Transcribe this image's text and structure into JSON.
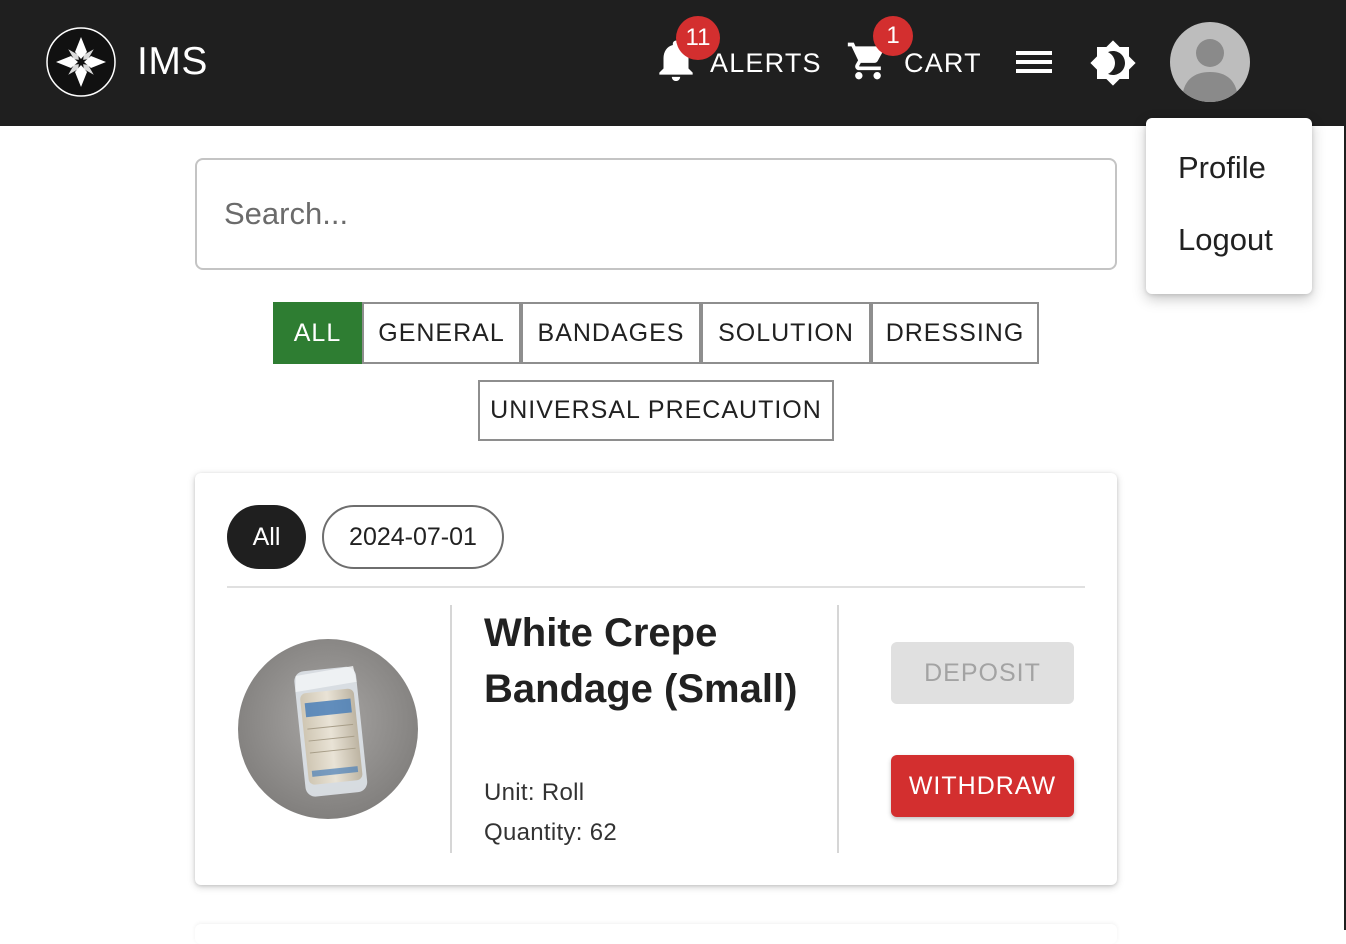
{
  "app": {
    "title": "IMS",
    "logo_icon": "maltese-cross-icon"
  },
  "nav": {
    "alerts": {
      "label": "ALERTS",
      "count": "11",
      "icon": "bell-icon"
    },
    "cart": {
      "label": "CART",
      "count": "1",
      "icon": "cart-icon"
    },
    "menu_icon": "hamburger-menu-icon",
    "theme_icon": "brightness-toggle-icon",
    "avatar_icon": "user-avatar-icon"
  },
  "user_menu": {
    "items": [
      {
        "label": "Profile"
      },
      {
        "label": "Logout"
      }
    ]
  },
  "search": {
    "placeholder": "Search...",
    "value": ""
  },
  "categories": {
    "selected": "ALL",
    "items": [
      {
        "label": "ALL"
      },
      {
        "label": "GENERAL"
      },
      {
        "label": "BANDAGES"
      },
      {
        "label": "SOLUTION"
      },
      {
        "label": "DRESSING"
      },
      {
        "label": "UNIVERSAL PRECAUTION"
      }
    ]
  },
  "card": {
    "chips": [
      {
        "label": "All",
        "selected": true
      },
      {
        "label": "2024-07-01",
        "selected": false
      }
    ],
    "item": {
      "name": "White Crepe Bandage (Small)",
      "unit": "Unit: Roll",
      "quantity": "Quantity: 62",
      "image": "crepe-bandage-roll-photo"
    },
    "actions": {
      "deposit": "DEPOSIT",
      "withdraw": "WITHDRAW"
    }
  },
  "colors": {
    "appbar": "#1f1f1f",
    "badge": "#d32f2f",
    "active_category": "#2e7d32",
    "withdraw": "#d32f2f"
  }
}
